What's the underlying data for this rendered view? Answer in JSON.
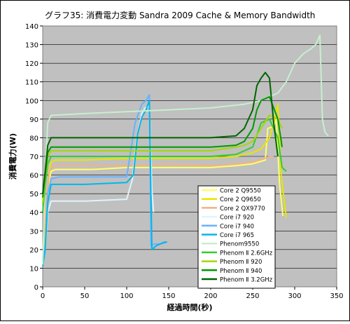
{
  "chart_data": {
    "type": "line",
    "title": "グラフ35: 消費電力変動 Sandra 2009 Cache & Memory Bandwidth",
    "xlabel": "経過時間(秒)",
    "ylabel": "消費電力(W)",
    "xlim": [
      0,
      350
    ],
    "ylim": [
      0,
      140
    ],
    "xticks": [
      0,
      50,
      100,
      150,
      200,
      250,
      300,
      350
    ],
    "yticks": [
      0,
      10,
      20,
      30,
      40,
      50,
      60,
      70,
      80,
      90,
      100,
      110,
      120,
      130,
      140
    ],
    "grid": true,
    "plot_background": "#c0c0c0",
    "legend_position": "bottom-right, inside plot",
    "series": [
      {
        "name": "Core 2 Q9550",
        "color": "#ffff66",
        "x": [
          0,
          3,
          8,
          10,
          15,
          30,
          60,
          100,
          150,
          200,
          230,
          250,
          257,
          265,
          268,
          275,
          278,
          282,
          286
        ],
        "y": [
          12,
          30,
          58,
          62,
          63,
          63,
          63,
          64,
          64,
          64,
          65,
          66,
          67,
          68,
          85,
          86,
          90,
          55,
          38
        ]
      },
      {
        "name": "Core 2 Q9650",
        "color": "#e6e600",
        "x": [
          0,
          3,
          8,
          10,
          15,
          50,
          100,
          150,
          200,
          230,
          250,
          260,
          270,
          275,
          280,
          284,
          290
        ],
        "y": [
          12,
          35,
          63,
          67,
          68,
          68,
          69,
          69,
          69,
          70,
          72,
          74,
          80,
          88,
          98,
          60,
          37
        ]
      },
      {
        "name": "Core 2 QX9770",
        "color": "#f4b183",
        "x": [
          0,
          3,
          8,
          10,
          15,
          50,
          100,
          150,
          200,
          230,
          250,
          265,
          270,
          275
        ],
        "y": [
          14,
          40,
          62,
          64,
          65,
          65,
          65,
          66,
          65,
          66,
          67,
          69,
          70,
          70
        ]
      },
      {
        "name": "Core i7 920",
        "color": "#dff4fb",
        "x": [
          0,
          3,
          6,
          10,
          20,
          50,
          100,
          107,
          112,
          118,
          122,
          127,
          130,
          132
        ],
        "y": [
          12,
          20,
          40,
          46,
          46,
          46,
          47,
          58,
          80,
          93,
          96,
          97,
          52,
          40
        ]
      },
      {
        "name": "Core i7 940",
        "color": "#66b3ff",
        "x": [
          0,
          3,
          6,
          10,
          20,
          50,
          100,
          110,
          118,
          123,
          127,
          129,
          133,
          140,
          148
        ],
        "y": [
          12,
          22,
          50,
          58,
          59,
          59,
          59,
          88,
          98,
          100,
          103,
          22,
          23,
          23,
          24
        ]
      },
      {
        "name": "Core i7 965",
        "color": "#00b7eb",
        "x": [
          0,
          3,
          6,
          10,
          20,
          50,
          100,
          108,
          113,
          118,
          123,
          127,
          130,
          135,
          145,
          148
        ],
        "y": [
          11,
          20,
          45,
          55,
          55,
          55,
          56,
          60,
          82,
          91,
          95,
          100,
          20,
          22,
          24,
          24
        ]
      },
      {
        "name": "Phenom9550",
        "color": "#c6efce",
        "x": [
          0,
          3,
          6,
          10,
          50,
          100,
          150,
          200,
          240,
          260,
          280,
          290,
          300,
          310,
          320,
          325,
          330,
          333,
          336,
          340
        ],
        "y": [
          12,
          60,
          88,
          92,
          93,
          94,
          95,
          96,
          98,
          100,
          104,
          110,
          120,
          125,
          128,
          130,
          135,
          90,
          83,
          81
        ]
      },
      {
        "name": "Phenom Ⅱ 2.6GHz",
        "color": "#33cc33",
        "x": [
          0,
          3,
          6,
          10,
          50,
          100,
          150,
          200,
          230,
          240,
          250,
          260,
          270,
          280,
          285,
          290
        ],
        "y": [
          40,
          55,
          66,
          70,
          70,
          70,
          70,
          70,
          71,
          73,
          75,
          88,
          90,
          80,
          64,
          62
        ]
      },
      {
        "name": "Phenom Ⅱ 920",
        "color": "#a6d608",
        "x": [
          0,
          3,
          6,
          10,
          50,
          100,
          150,
          200,
          230,
          240,
          250,
          260,
          270,
          280,
          285
        ],
        "y": [
          45,
          58,
          70,
          73,
          73,
          73,
          73,
          73,
          75,
          76,
          78,
          85,
          92,
          90,
          85
        ]
      },
      {
        "name": "Phenom Ⅱ 940",
        "color": "#009900",
        "x": [
          0,
          3,
          6,
          10,
          50,
          100,
          150,
          200,
          230,
          240,
          250,
          255,
          260,
          270,
          280,
          285
        ],
        "y": [
          48,
          60,
          72,
          75,
          75,
          75,
          75,
          75,
          76,
          78,
          85,
          95,
          100,
          102,
          90,
          75
        ]
      },
      {
        "name": "Phenom Ⅱ 3.2GHz",
        "color": "#006400",
        "x": [
          0,
          3,
          6,
          10,
          50,
          100,
          150,
          200,
          230,
          240,
          250,
          255,
          260,
          265,
          270,
          275,
          280
        ],
        "y": [
          50,
          62,
          76,
          80,
          80,
          80,
          80,
          80,
          81,
          85,
          95,
          108,
          112,
          115,
          112,
          88,
          70
        ]
      }
    ]
  }
}
